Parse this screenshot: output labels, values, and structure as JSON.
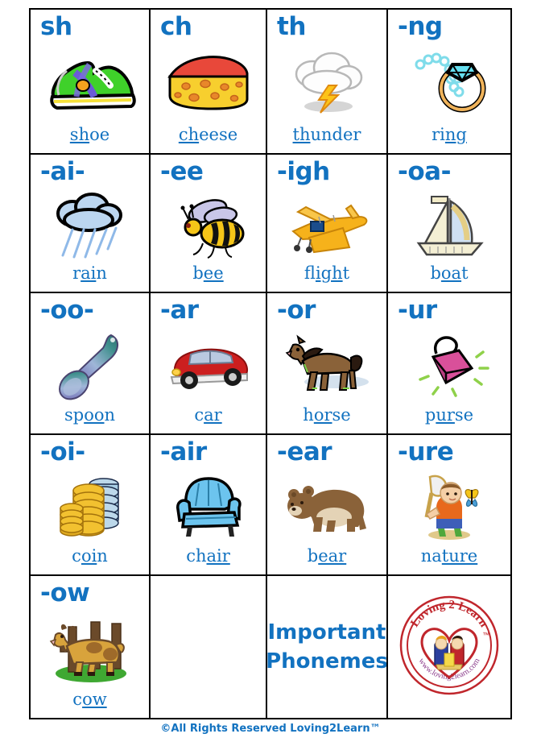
{
  "sheet": {
    "footer": "©All Rights Reserved Loving2Learn™",
    "accent_blue": "#1272c0",
    "border_color": "#000000",
    "background": "#ffffff"
  },
  "title_cell": {
    "line1": "Important",
    "line2": "Phonemes"
  },
  "logo": {
    "alt": "Loving2Learn logo",
    "ring_top_text": "Loving 2 Learn",
    "ring_bottom_text": "www.loving2learn.com",
    "trademark": "™",
    "color": "#c0262c"
  },
  "cells": [
    {
      "row": 1,
      "col": 1,
      "type": "phoneme",
      "phoneme": "sh",
      "word_pre": "",
      "word_mark": "sh",
      "word_post": "oe",
      "word": "shoe",
      "icon": "shoe-icon"
    },
    {
      "row": 1,
      "col": 2,
      "type": "phoneme",
      "phoneme": "ch",
      "word_pre": "",
      "word_mark": "ch",
      "word_post": "eese",
      "word": "cheese",
      "icon": "cheese-icon"
    },
    {
      "row": 1,
      "col": 3,
      "type": "phoneme",
      "phoneme": "th",
      "word_pre": "",
      "word_mark": "th",
      "word_post": "under",
      "word": "thunder",
      "icon": "thunder-cloud-icon"
    },
    {
      "row": 1,
      "col": 4,
      "type": "phoneme",
      "phoneme": "-ng",
      "word_pre": "ri",
      "word_mark": "ng",
      "word_post": "",
      "word": "ring",
      "icon": "ring-icon"
    },
    {
      "row": 2,
      "col": 1,
      "type": "phoneme",
      "phoneme": "-ai-",
      "word_pre": "r",
      "word_mark": "ai",
      "word_post": "n",
      "word": "rain",
      "icon": "rain-cloud-icon"
    },
    {
      "row": 2,
      "col": 2,
      "type": "phoneme",
      "phoneme": "-ee",
      "word_pre": "b",
      "word_mark": "ee",
      "word_post": "",
      "word": "bee",
      "icon": "bee-icon"
    },
    {
      "row": 2,
      "col": 3,
      "type": "phoneme",
      "phoneme": "-igh",
      "word_pre": "fl",
      "word_mark": "igh",
      "word_post": "t",
      "word": "flight",
      "icon": "airplane-icon"
    },
    {
      "row": 2,
      "col": 4,
      "type": "phoneme",
      "phoneme": "-oa-",
      "word_pre": "b",
      "word_mark": "oa",
      "word_post": "t",
      "word": "boat",
      "icon": "sailboat-icon"
    },
    {
      "row": 3,
      "col": 1,
      "type": "phoneme",
      "phoneme": "-oo-",
      "word_pre": "sp",
      "word_mark": "oo",
      "word_post": "n",
      "word": "spoon",
      "icon": "spoon-icon"
    },
    {
      "row": 3,
      "col": 2,
      "type": "phoneme",
      "phoneme": "-ar",
      "word_pre": "c",
      "word_mark": "ar",
      "word_post": "",
      "word": "car",
      "icon": "car-icon"
    },
    {
      "row": 3,
      "col": 3,
      "type": "phoneme",
      "phoneme": "-or",
      "word_pre": "h",
      "word_mark": "or",
      "word_post": "se",
      "word": "horse",
      "icon": "horse-icon"
    },
    {
      "row": 3,
      "col": 4,
      "type": "phoneme",
      "phoneme": "-ur",
      "word_pre": "p",
      "word_mark": "ur",
      "word_post": "se",
      "word": "purse",
      "icon": "purse-icon"
    },
    {
      "row": 4,
      "col": 1,
      "type": "phoneme",
      "phoneme": "-oi-",
      "word_pre": "c",
      "word_mark": "oi",
      "word_post": "n",
      "word": "coin",
      "icon": "coins-icon"
    },
    {
      "row": 4,
      "col": 2,
      "type": "phoneme",
      "phoneme": "-air",
      "word_pre": "ch",
      "word_mark": "air",
      "word_post": "",
      "word": "chair",
      "icon": "armchair-icon"
    },
    {
      "row": 4,
      "col": 3,
      "type": "phoneme",
      "phoneme": "-ear",
      "word_pre": "b",
      "word_mark": "ear",
      "word_post": "",
      "word": "bear",
      "icon": "bear-icon"
    },
    {
      "row": 4,
      "col": 4,
      "type": "phoneme",
      "phoneme": "-ure",
      "word_pre": "na",
      "word_mark": "ture",
      "word_post": "",
      "word": "nature",
      "icon": "child-butterfly-net-icon"
    },
    {
      "row": 5,
      "col": 1,
      "type": "phoneme",
      "phoneme": "-ow",
      "word_pre": "c",
      "word_mark": "ow",
      "word_post": "",
      "word": "cow",
      "icon": "cow-icon"
    },
    {
      "row": 5,
      "col": 2,
      "type": "blank"
    },
    {
      "row": 5,
      "col": 3,
      "type": "title"
    },
    {
      "row": 5,
      "col": 4,
      "type": "logo"
    }
  ]
}
